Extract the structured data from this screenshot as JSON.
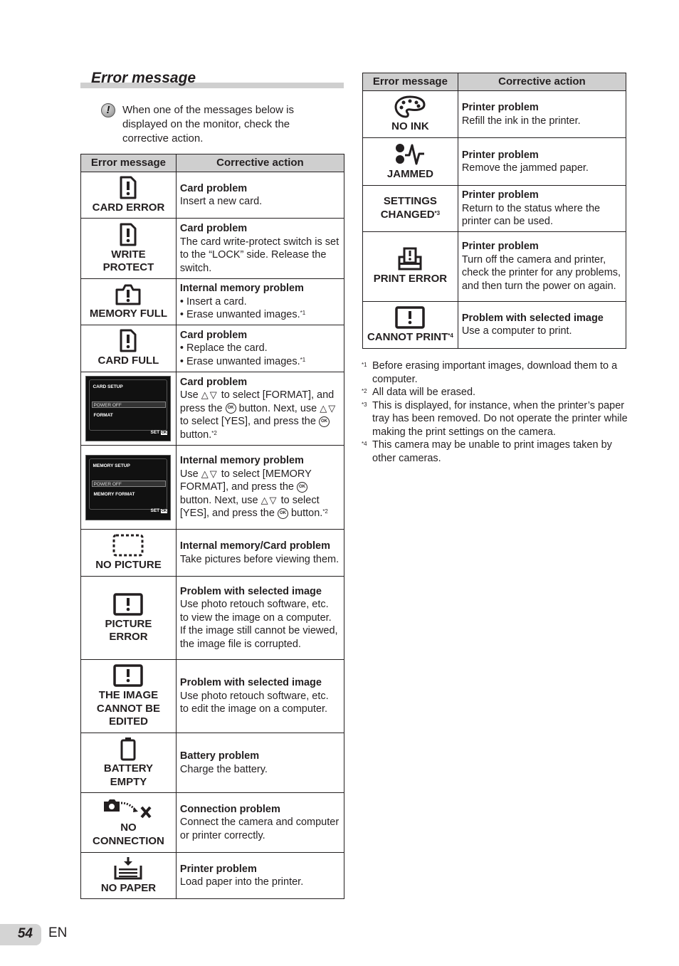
{
  "section": {
    "title": "Error message",
    "note_icon": "caution-icon",
    "note": "When one of the messages below is displayed on the monitor, check the corrective action."
  },
  "table_headers": {
    "error_message": "Error message",
    "corrective_action": "Corrective action"
  },
  "left_table": [
    {
      "icon": "card-error-icon",
      "message": "CARD ERROR",
      "title": "Card problem",
      "lines": [
        "Insert a new card."
      ]
    },
    {
      "icon": "write-protect-icon",
      "message": "WRITE PROTECT",
      "title": "Card problem",
      "lines": [
        "The card write-protect switch is set to the “LOCK” side. Release the switch."
      ]
    },
    {
      "icon": "memory-full-icon",
      "message": "MEMORY FULL",
      "title": "Internal memory problem",
      "bullets": [
        "Insert a card.",
        "Erase unwanted images."
      ],
      "bullet_footnote": "*1"
    },
    {
      "icon": "card-full-icon",
      "message": "CARD FULL",
      "title": "Card problem",
      "bullets": [
        "Replace the card.",
        "Erase unwanted images."
      ],
      "bullet_footnote": "*1"
    },
    {
      "screen": {
        "header": "CARD SETUP",
        "selected": "POWER OFF",
        "option": "FORMAT",
        "set_label": "SET",
        "ok": "OK"
      },
      "title": "Card problem",
      "parts": [
        "Use",
        "to select [FORMAT], and press the",
        "button. Next, use",
        "to select [YES], and press the",
        "button."
      ],
      "footnote": "*2"
    },
    {
      "screen": {
        "header": "MEMORY SETUP",
        "selected": "POWER OFF",
        "option": "MEMORY FORMAT",
        "set_label": "SET",
        "ok": "OK"
      },
      "title": "Internal memory problem",
      "parts": [
        "Use",
        "to select [MEMORY FORMAT], and press the",
        "button. Next, use",
        "to select [YES], and press the",
        "button."
      ],
      "footnote": "*2"
    },
    {
      "icon": "no-picture-icon",
      "message": "NO PICTURE",
      "title": "Internal memory/Card problem",
      "lines": [
        "Take pictures before viewing them."
      ]
    },
    {
      "icon": "picture-error-icon",
      "message": "PICTURE ERROR",
      "title": "Problem with selected image",
      "lines": [
        "Use photo retouch software, etc. to view the image on a computer. If the image still cannot be viewed, the image file is corrupted."
      ]
    },
    {
      "icon": "cannot-edit-icon",
      "message": "THE IMAGE CANNOT BE EDITED",
      "title": "Problem with selected image",
      "lines": [
        "Use photo retouch software, etc. to edit the image on a computer."
      ]
    },
    {
      "icon": "battery-empty-icon",
      "message": "BATTERY EMPTY",
      "title": "Battery problem",
      "lines": [
        "Charge the battery."
      ]
    },
    {
      "icon": "no-connection-icon",
      "message": "NO CONNECTION",
      "title": "Connection problem",
      "lines": [
        "Connect the camera and computer or printer correctly."
      ]
    },
    {
      "icon": "no-paper-icon",
      "message": "NO PAPER",
      "title": "Printer problem",
      "lines": [
        "Load paper into the printer."
      ]
    }
  ],
  "right_table": [
    {
      "icon": "no-ink-icon",
      "message": "NO INK",
      "title": "Printer problem",
      "lines": [
        "Refill the ink in the printer."
      ]
    },
    {
      "icon": "jammed-icon",
      "message": "JAMMED",
      "title": "Printer problem",
      "lines": [
        "Remove the jammed paper."
      ]
    },
    {
      "message": "SETTINGS CHANGED",
      "message_footnote": "*3",
      "title": "Printer problem",
      "lines": [
        "Return to the status where the printer can be used."
      ]
    },
    {
      "icon": "print-error-icon",
      "message": "PRINT ERROR",
      "title": "Printer problem",
      "lines": [
        "Turn off the camera and printer, check the printer for any problems, and then turn the power on again."
      ]
    },
    {
      "icon": "cannot-print-icon",
      "message": "CANNOT PRINT",
      "message_footnote": "*4",
      "title": "Problem with selected image",
      "lines": [
        "Use a computer to print."
      ]
    }
  ],
  "footnotes": [
    {
      "mark": "*1",
      "text": "Before erasing important images, download them to a computer."
    },
    {
      "mark": "*2",
      "text": "All data will be erased."
    },
    {
      "mark": "*3",
      "text": "This is displayed, for instance, when the printer’s paper tray has been removed. Do not operate the printer while making the print settings on the camera."
    },
    {
      "mark": "*4",
      "text": "This camera may be unable to print images taken by other cameras."
    }
  ],
  "symbols": {
    "up_down": "△▽",
    "ok_button": "OK"
  },
  "page": {
    "number": "54",
    "language": "EN"
  }
}
